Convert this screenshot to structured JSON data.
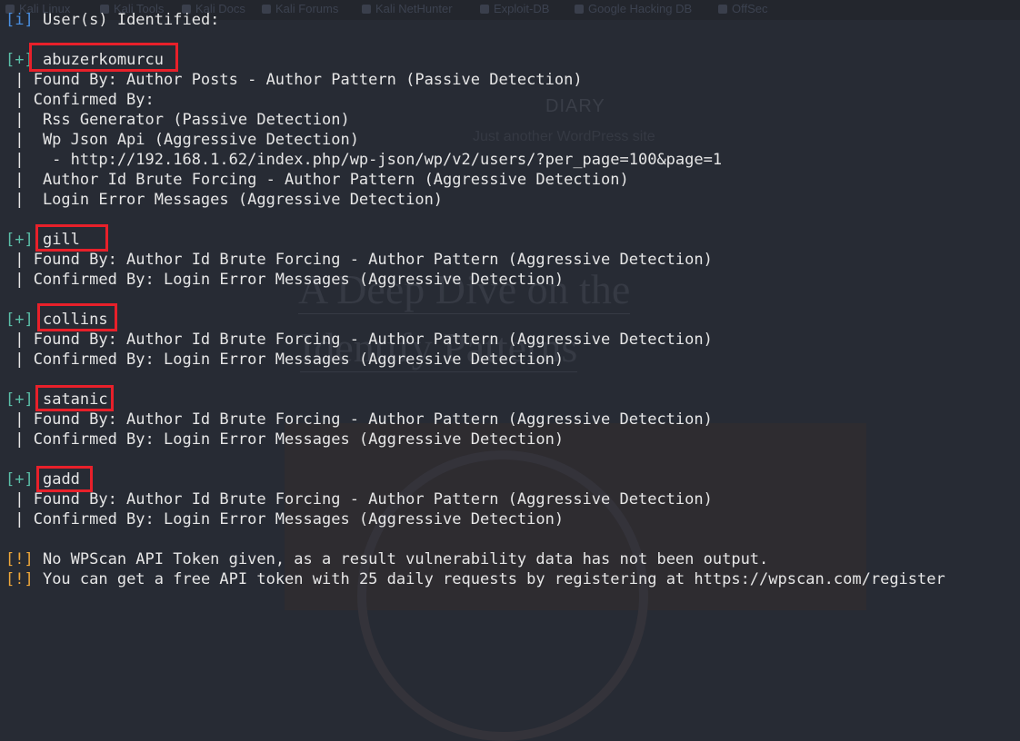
{
  "background": {
    "bookmarks": [
      "Kali Linux",
      "Kali Tools",
      "Kali Docs",
      "Kali Forums",
      "Kali NetHunter",
      "Exploit-DB",
      "Google Hacking DB",
      "OffSec"
    ],
    "site_title": "DIARY",
    "site_tagline": "Just another WordPress site",
    "post_heading_line1": "A Deep Dive on the",
    "post_heading_line2": "Identify Patterns"
  },
  "terminal": {
    "header": {
      "tag": "[i]",
      "text": " User(s) Identified:"
    },
    "users": [
      {
        "tag": "[+]",
        "name": "abuzerkomurcu",
        "details": [
          " | Found By: Author Posts - Author Pattern (Passive Detection)",
          " | Confirmed By:",
          " |  Rss Generator (Passive Detection)",
          " |  Wp Json Api (Aggressive Detection)",
          " |   - http://192.168.1.62/index.php/wp-json/wp/v2/users/?per_page=100&page=1",
          " |  Author Id Brute Forcing - Author Pattern (Aggressive Detection)",
          " |  Login Error Messages (Aggressive Detection)"
        ]
      },
      {
        "tag": "[+]",
        "name": "gill",
        "details": [
          " | Found By: Author Id Brute Forcing - Author Pattern (Aggressive Detection)",
          " | Confirmed By: Login Error Messages (Aggressive Detection)"
        ]
      },
      {
        "tag": "[+]",
        "name": "collins",
        "details": [
          " | Found By: Author Id Brute Forcing - Author Pattern (Aggressive Detection)",
          " | Confirmed By: Login Error Messages (Aggressive Detection)"
        ]
      },
      {
        "tag": "[+]",
        "name": "satanic",
        "details": [
          " | Found By: Author Id Brute Forcing - Author Pattern (Aggressive Detection)",
          " | Confirmed By: Login Error Messages (Aggressive Detection)"
        ]
      },
      {
        "tag": "[+]",
        "name": "gadd",
        "details": [
          " | Found By: Author Id Brute Forcing - Author Pattern (Aggressive Detection)",
          " | Confirmed By: Login Error Messages (Aggressive Detection)"
        ]
      }
    ],
    "warnings": [
      {
        "tag": "[!]",
        "text": " No WPScan API Token given, as a result vulnerability data has not been output."
      },
      {
        "tag": "[!]",
        "text": " You can get a free API token with 25 daily requests by registering at https://wpscan.com/register"
      }
    ],
    "colors": {
      "info_tag": "#4a90e2",
      "plus_tag": "#5bbfa8",
      "warn_tag": "#f0a83a",
      "highlight_box": "#e8202a",
      "text": "#e6e6e6",
      "background": "#272b34"
    }
  }
}
